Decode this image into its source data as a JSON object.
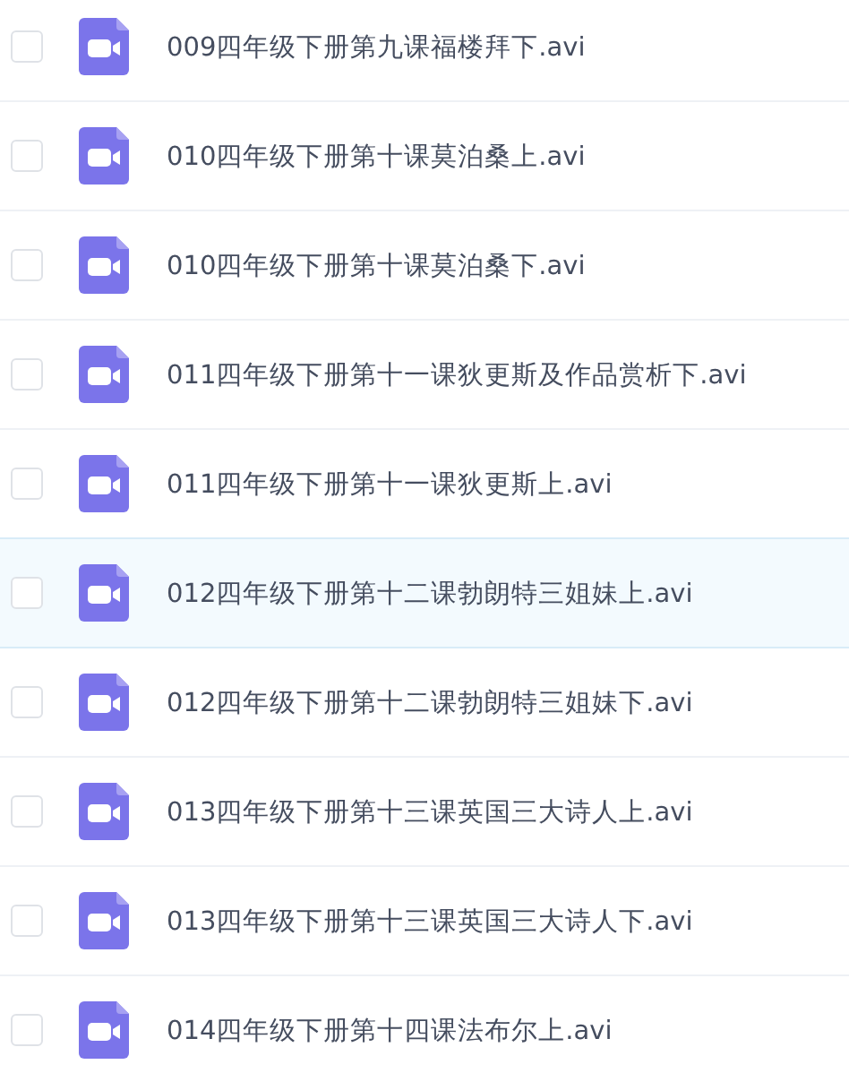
{
  "files": [
    {
      "name": "009四年级下册第九课福楼拜下.avi",
      "checked": false,
      "highlighted": false
    },
    {
      "name": "010四年级下册第十课莫泊桑上.avi",
      "checked": false,
      "highlighted": false
    },
    {
      "name": "010四年级下册第十课莫泊桑下.avi",
      "checked": false,
      "highlighted": false
    },
    {
      "name": "011四年级下册第十一课狄更斯及作品赏析下.avi",
      "checked": false,
      "highlighted": false
    },
    {
      "name": "011四年级下册第十一课狄更斯上.avi",
      "checked": false,
      "highlighted": false
    },
    {
      "name": "012四年级下册第十二课勃朗特三姐妹上.avi",
      "checked": false,
      "highlighted": true
    },
    {
      "name": "012四年级下册第十二课勃朗特三姐妹下.avi",
      "checked": false,
      "highlighted": false
    },
    {
      "name": "013四年级下册第十三课英国三大诗人上.avi",
      "checked": false,
      "highlighted": false
    },
    {
      "name": "013四年级下册第十三课英国三大诗人下.avi",
      "checked": false,
      "highlighted": false
    },
    {
      "name": "014四年级下册第十四课法布尔上.avi",
      "checked": false,
      "highlighted": false
    }
  ]
}
